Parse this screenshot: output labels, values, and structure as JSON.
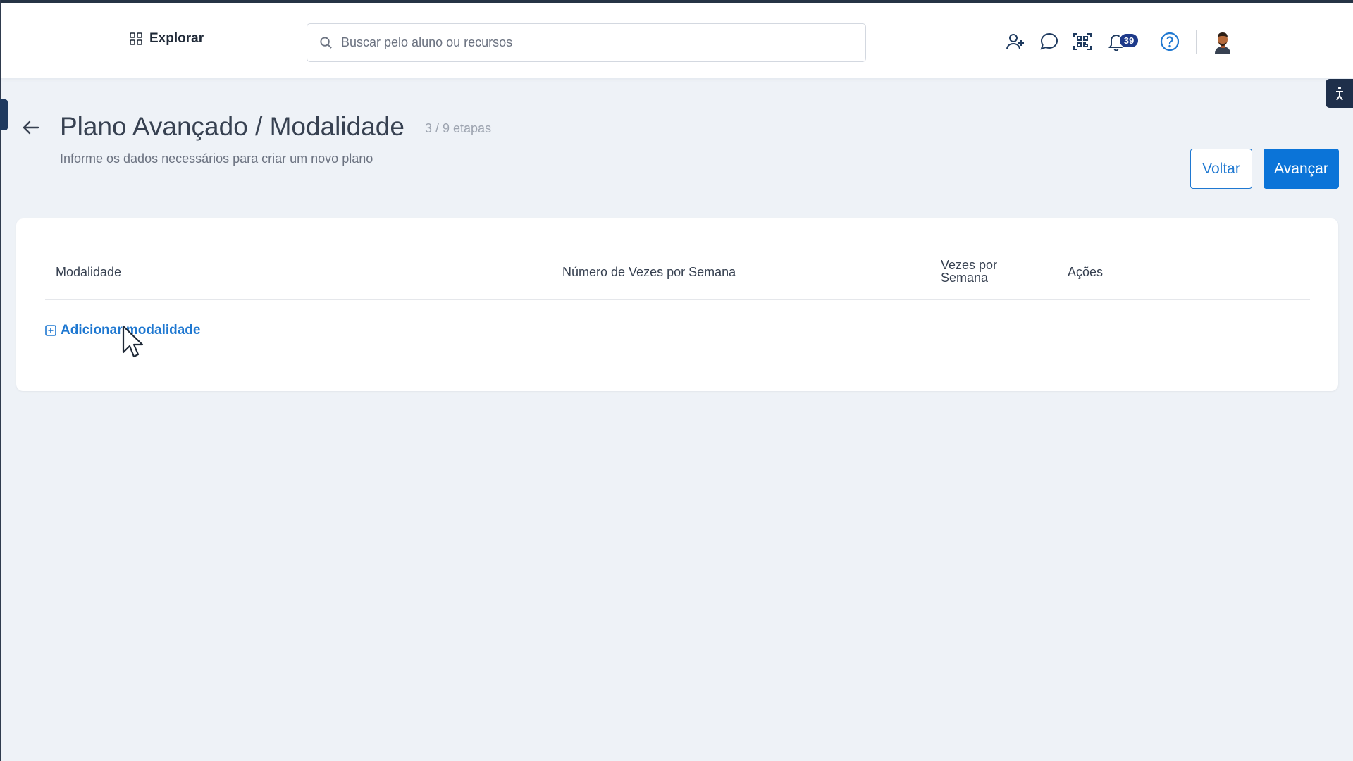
{
  "topbar": {
    "explore_label": "Explorar",
    "search_placeholder": "Buscar pelo aluno ou recursos",
    "notification_count": "39",
    "icons": [
      "grid-icon",
      "search-icon",
      "add-user-icon",
      "chat-icon",
      "qr-scan-icon",
      "bell-icon",
      "help-icon",
      "avatar"
    ]
  },
  "header": {
    "title": "Plano Avançado / Modalidade",
    "steps": "3 / 9 etapas",
    "subtitle": "Informe os dados necessários para criar um novo plano"
  },
  "actions": {
    "back_label": "Voltar",
    "next_label": "Avançar"
  },
  "table": {
    "columns": [
      "Modalidade",
      "Número de Vezes por Semana",
      "Vezes por Semana",
      "Ações"
    ],
    "rows": []
  },
  "add_link": {
    "label": "Adicionar modalidade"
  },
  "colors": {
    "accent": "#0b74d8",
    "link": "#1f78d1",
    "badge": "#1e3a8a",
    "page_bg": "#eef2f7"
  }
}
